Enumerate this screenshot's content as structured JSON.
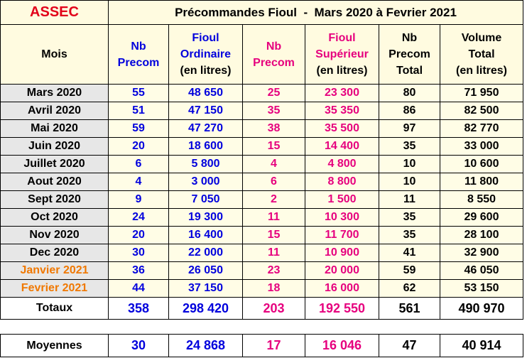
{
  "brand": "ASSEC",
  "title": "Précommandes Fioul  -  Mars 2020 à Fevrier 2021",
  "headers": {
    "mois": "Mois",
    "nb_precom_ord_1": "Nb",
    "nb_precom_ord_2": "Precom",
    "fioul_ord_1": "Fioul",
    "fioul_ord_2": "Ordinaire",
    "fioul_ord_3": "(en litres)",
    "nb_precom_sup_1": "Nb",
    "nb_precom_sup_2": "Precom",
    "fioul_sup_1": "Fioul",
    "fioul_sup_2": "Supérieur",
    "fioul_sup_3": "(en litres)",
    "nb_total_1": "Nb",
    "nb_total_2": "Precom",
    "nb_total_3": "Total",
    "vol_total_1": "Volume",
    "vol_total_2": "Total",
    "vol_total_3": "(en litres)"
  },
  "rows": [
    {
      "mois": "Mars 2020",
      "nb_ord": "55",
      "fioul_ord": "48 650",
      "nb_sup": "25",
      "fioul_sup": "23 300",
      "nb_total": "80",
      "vol_total": "71 950"
    },
    {
      "mois": "Avril 2020",
      "nb_ord": "51",
      "fioul_ord": "47 150",
      "nb_sup": "35",
      "fioul_sup": "35 350",
      "nb_total": "86",
      "vol_total": "82 500"
    },
    {
      "mois": "Mai 2020",
      "nb_ord": "59",
      "fioul_ord": "47 270",
      "nb_sup": "38",
      "fioul_sup": "35 500",
      "nb_total": "97",
      "vol_total": "82 770"
    },
    {
      "mois": "Juin 2020",
      "nb_ord": "20",
      "fioul_ord": "18 600",
      "nb_sup": "15",
      "fioul_sup": "14 400",
      "nb_total": "35",
      "vol_total": "33 000"
    },
    {
      "mois": "Juillet 2020",
      "nb_ord": "6",
      "fioul_ord": "5 800",
      "nb_sup": "4",
      "fioul_sup": "4 800",
      "nb_total": "10",
      "vol_total": "10 600"
    },
    {
      "mois": "Aout 2020",
      "nb_ord": "4",
      "fioul_ord": "3 000",
      "nb_sup": "6",
      "fioul_sup": "8 800",
      "nb_total": "10",
      "vol_total": "11 800"
    },
    {
      "mois": "Sept 2020",
      "nb_ord": "9",
      "fioul_ord": "7 050",
      "nb_sup": "2",
      "fioul_sup": "1 500",
      "nb_total": "11",
      "vol_total": "8 550"
    },
    {
      "mois": "Oct 2020",
      "nb_ord": "24",
      "fioul_ord": "19 300",
      "nb_sup": "11",
      "fioul_sup": "10 300",
      "nb_total": "35",
      "vol_total": "29 600"
    },
    {
      "mois": "Nov 2020",
      "nb_ord": "20",
      "fioul_ord": "16 400",
      "nb_sup": "15",
      "fioul_sup": "11 700",
      "nb_total": "35",
      "vol_total": "28 100"
    },
    {
      "mois": "Dec 2020",
      "nb_ord": "30",
      "fioul_ord": "22 000",
      "nb_sup": "11",
      "fioul_sup": "10 900",
      "nb_total": "41",
      "vol_total": "32 900"
    },
    {
      "mois": "Janvier 2021",
      "nb_ord": "36",
      "fioul_ord": "26 050",
      "nb_sup": "23",
      "fioul_sup": "20 000",
      "nb_total": "59",
      "vol_total": "46 050"
    },
    {
      "mois": "Fevrier 2021",
      "nb_ord": "44",
      "fioul_ord": "37 150",
      "nb_sup": "18",
      "fioul_sup": "16 000",
      "nb_total": "62",
      "vol_total": "53 150"
    }
  ],
  "totals": {
    "label": "Totaux",
    "nb_ord": "358",
    "fioul_ord": "298 420",
    "nb_sup": "203",
    "fioul_sup": "192 550",
    "nb_total": "561",
    "vol_total": "490 970"
  },
  "averages": {
    "label": "Moyennes",
    "nb_ord": "30",
    "fioul_ord": "24 868",
    "nb_sup": "17",
    "fioul_sup": "16 046",
    "nb_total": "47",
    "vol_total": "40 914"
  },
  "colors": {
    "brand_red": "#e2001a",
    "ordinaire_blue": "#0000dd",
    "superieur_pink": "#e6007e",
    "year_2021_orange": "#f07800",
    "header_bg": "#fffbe0",
    "mois_bg": "#e7e7e7"
  }
}
